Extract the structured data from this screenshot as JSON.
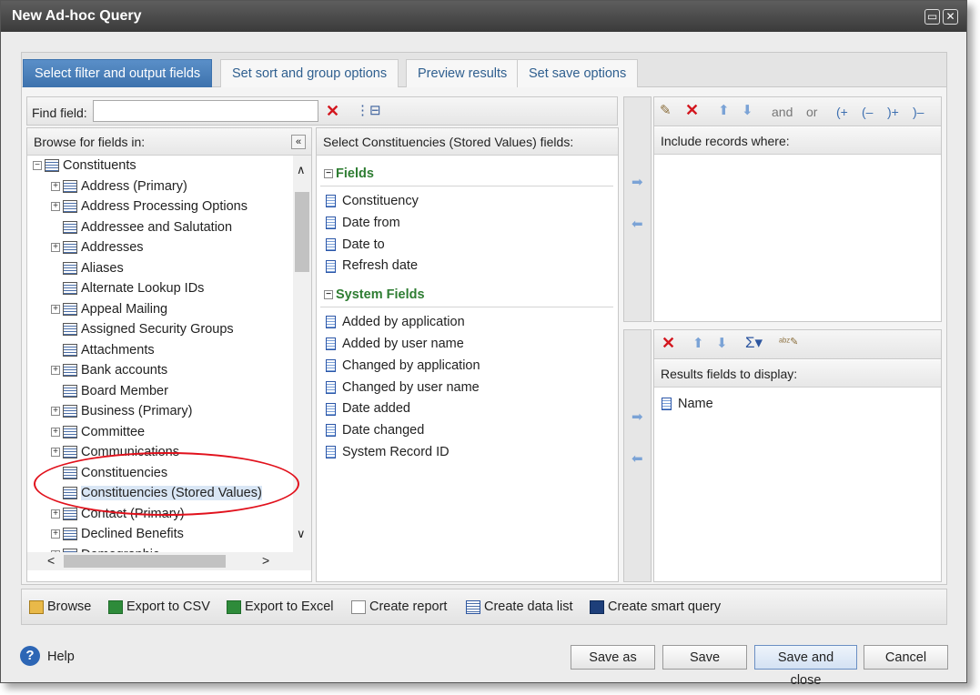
{
  "window": {
    "title": "New Ad-hoc Query"
  },
  "tabs": [
    {
      "label": "Select filter and output fields",
      "active": true
    },
    {
      "label": "Set sort and group options"
    },
    {
      "label": "Preview results"
    },
    {
      "label": "Set save options"
    }
  ],
  "find": {
    "label": "Find field:",
    "value": ""
  },
  "browse": {
    "header": "Browse for fields in:",
    "root": "Constituents",
    "items": [
      {
        "label": "Address (Primary)",
        "expandable": true
      },
      {
        "label": "Address Processing Options",
        "expandable": true
      },
      {
        "label": "Addressee and Salutation",
        "expandable": false
      },
      {
        "label": "Addresses",
        "expandable": true
      },
      {
        "label": "Aliases",
        "expandable": false
      },
      {
        "label": "Alternate Lookup IDs",
        "expandable": false
      },
      {
        "label": "Appeal Mailing",
        "expandable": true
      },
      {
        "label": "Assigned Security Groups",
        "expandable": false
      },
      {
        "label": "Attachments",
        "expandable": false
      },
      {
        "label": "Bank accounts",
        "expandable": true
      },
      {
        "label": "Board Member",
        "expandable": false
      },
      {
        "label": "Business (Primary)",
        "expandable": true
      },
      {
        "label": "Committee",
        "expandable": true
      },
      {
        "label": "Communications",
        "expandable": true
      },
      {
        "label": "Constituencies",
        "expandable": false
      },
      {
        "label": "Constituencies (Stored Values)",
        "expandable": false,
        "selected": true
      },
      {
        "label": "Contact (Primary)",
        "expandable": true
      },
      {
        "label": "Declined Benefits",
        "expandable": true
      },
      {
        "label": "Demographic",
        "expandable": true
      }
    ]
  },
  "fields_panel": {
    "header": "Select Constituencies (Stored Values) fields:",
    "groups": [
      {
        "name": "Fields",
        "items": [
          "Constituency",
          "Date from",
          "Date to",
          "Refresh date"
        ]
      },
      {
        "name": "System Fields",
        "items": [
          "Added by application",
          "Added by user name",
          "Changed by application",
          "Changed by user name",
          "Date added",
          "Date changed",
          "System Record ID"
        ]
      }
    ]
  },
  "filter": {
    "header": "Include records where:",
    "toolbar": {
      "and": "and",
      "or": "or",
      "open_and": "(+",
      "open_or": "(–",
      "close_and": ")+",
      "close_or": ")–"
    }
  },
  "results": {
    "header": "Results fields to display:",
    "fields": [
      "Name"
    ]
  },
  "bottom_toolbar": [
    {
      "label": "Browse",
      "icon": "folder-icon"
    },
    {
      "label": "Export to CSV",
      "icon": "csv-icon"
    },
    {
      "label": "Export to Excel",
      "icon": "excel-icon"
    },
    {
      "label": "Create report",
      "icon": "report-icon"
    },
    {
      "label": "Create data list",
      "icon": "data-list-icon"
    },
    {
      "label": "Create smart query",
      "icon": "smart-query-icon"
    }
  ],
  "footer": {
    "help": "Help",
    "save_as": "Save as",
    "save": "Save",
    "save_and_close": "Save and close",
    "cancel": "Cancel"
  }
}
